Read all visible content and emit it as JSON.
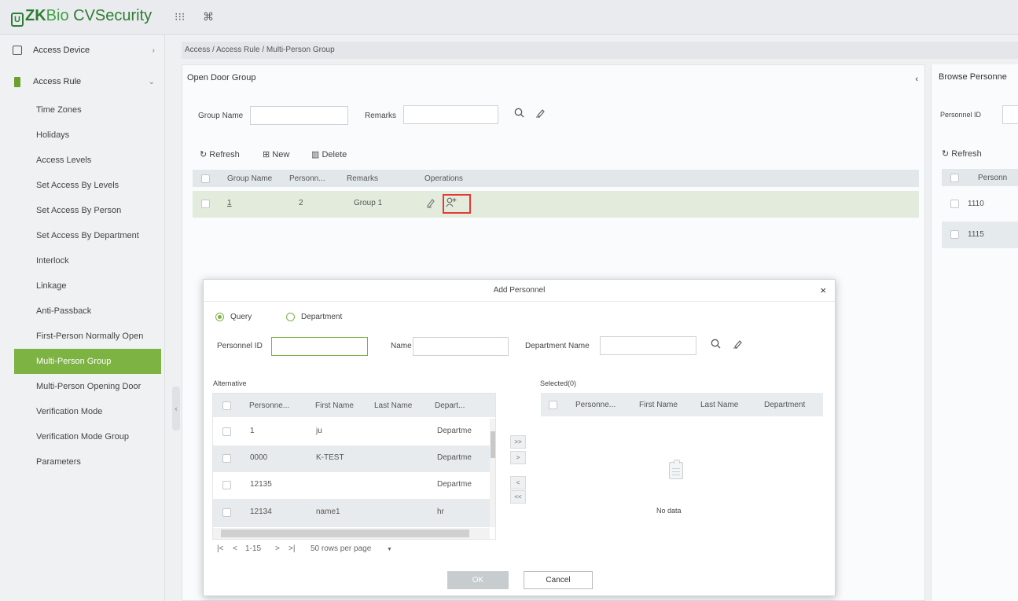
{
  "app": {
    "brand_mark": "U",
    "brand_zk": "ZK",
    "brand_bio": "Bio",
    "brand_cv": " CVSecurity",
    "apps_icon": "⁝⁝⁝",
    "cmd_icon": "⌘"
  },
  "sidebar": {
    "group_device": "Access Device",
    "group_rule": "Access Rule",
    "items": [
      "Time Zones",
      "Holidays",
      "Access Levels",
      "Set Access By Levels",
      "Set Access By Person",
      "Set Access By Department",
      "Interlock",
      "Linkage",
      "Anti-Passback",
      "First-Person Normally Open",
      "Multi-Person Group",
      "Multi-Person Opening Door",
      "Verification Mode",
      "Verification Mode Group",
      "Parameters"
    ],
    "collapse_glyph": "‹"
  },
  "breadcrumb": "Access / Access Rule / Multi-Person Group",
  "main": {
    "title": "Open Door Group",
    "collapse_glyph": "‹",
    "search": {
      "group_name_label": "Group Name",
      "group_name_value": "",
      "remarks_label": "Remarks",
      "remarks_value": ""
    },
    "toolbar": {
      "refresh": "Refresh",
      "new": "New",
      "delete": "Delete"
    },
    "columns": [
      "Group Name",
      "Personn...",
      "Remarks",
      "Operations"
    ],
    "rows": [
      {
        "group_name": "1",
        "personnel": "2",
        "remarks": "Group 1"
      }
    ]
  },
  "right_panel": {
    "title": "Browse Personne",
    "personnel_id_label": "Personnel ID",
    "refresh": "Refresh",
    "column": "Personn",
    "rows": [
      "1110",
      "1115"
    ]
  },
  "modal": {
    "title": "Add Personnel",
    "close": "×",
    "radio_query": "Query",
    "radio_department": "Department",
    "personnel_id_label": "Personnel ID",
    "personnel_id_value": "",
    "name_label": "Name",
    "name_value": "",
    "department_label": "Department Name",
    "department_value": "",
    "alternative_label": "Alternative",
    "alt_columns": [
      "Personne...",
      "First Name",
      "Last Name",
      "Depart..."
    ],
    "alt_rows": [
      {
        "id": "1",
        "first": "ju",
        "last": "",
        "dept": "Departme"
      },
      {
        "id": "0000",
        "first": "K-TEST",
        "last": "",
        "dept": "Departme"
      },
      {
        "id": "12135",
        "first": "",
        "last": "",
        "dept": "Departme"
      },
      {
        "id": "12134",
        "first": "name1",
        "last": "",
        "dept": "hr"
      }
    ],
    "move_buttons": [
      ">>",
      ">",
      "<",
      "<<"
    ],
    "selected_label": "Selected(0)",
    "sel_columns": [
      "Personne...",
      "First Name",
      "Last Name",
      "Department"
    ],
    "no_data": "No data",
    "pager": {
      "first": "|<",
      "prev": "<",
      "range": "1-15",
      "next": ">",
      "last": ">|",
      "rows_per_page": "50 rows per page"
    },
    "ok": "OK",
    "cancel": "Cancel"
  }
}
